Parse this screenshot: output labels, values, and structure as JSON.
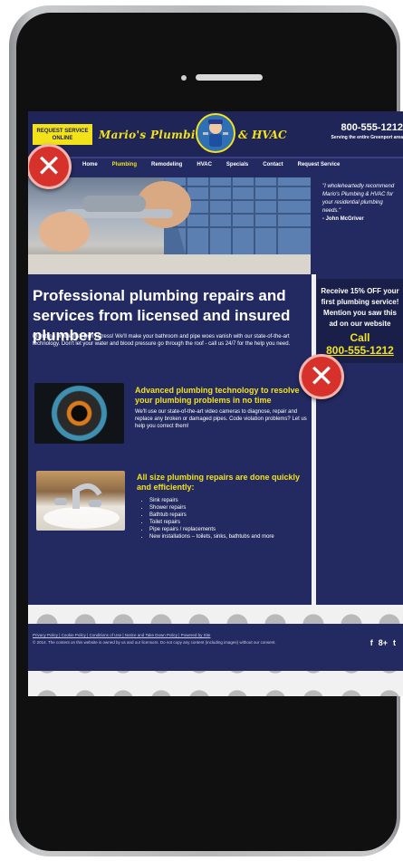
{
  "header": {
    "request_button": "REQUEST SERVICE ONLINE",
    "logo_left": "Mario's Plumbing",
    "logo_right": "& HVAC",
    "phone": "800-555-1212",
    "serving": "Serving the entire Greenport area"
  },
  "nav": [
    "Home",
    "Plumbing",
    "Remodeling",
    "HVAC",
    "Specials",
    "Contact",
    "Request Service"
  ],
  "main": {
    "headline": "Professional plumbing repairs and services from licensed and insured plumbers",
    "intro": "Plumbing problems? Don't stress! We'll make your bathroom and pipe woes vanish with our state-of-the-art technology. Don't let your water and blood pressure go through the roof - call us 24/7 for the help you need.",
    "feature1": {
      "title": "Advanced plumbing technology to resolve your plumbing problems in no time",
      "body": "We'll use our state-of-the-art video cameras to diagnose, repair and replace any broken or damaged pipes. Code violation problems? Let us help you correct them!"
    },
    "feature2": {
      "title": "All size plumbing repairs are done quickly and efficiently:",
      "items": [
        "Sink repairs",
        "Shower repairs",
        "Bathtub repairs",
        "Toilet repairs",
        "Pipe repairs / replacements",
        "New installations – toilets, sinks, bathtubs and more"
      ]
    }
  },
  "sidebar": {
    "quote": "\"I wholeheartedly recommend Mario's Plumbing & HVAC for your residential plumbing needs.\"",
    "author": "- John McGriver",
    "promo": "Receive 15% OFF your first plumbing service! Mention you saw this ad on our website",
    "call": "Call",
    "phone": "800-555-1212"
  },
  "footer": {
    "links": "Privacy Policy | Cookie Policy | Conditions of Use | Notice and Take Down Policy | Powered by Site",
    "copyright": "© 2014. The content on this website is owned by us and our licensors. Do not copy any content (including images) without our consent."
  },
  "social": [
    "f",
    "8+",
    "t"
  ],
  "colors": {
    "brand_navy": "#232a61",
    "accent_yellow": "#f2e21a",
    "error_red": "#d6312a"
  }
}
